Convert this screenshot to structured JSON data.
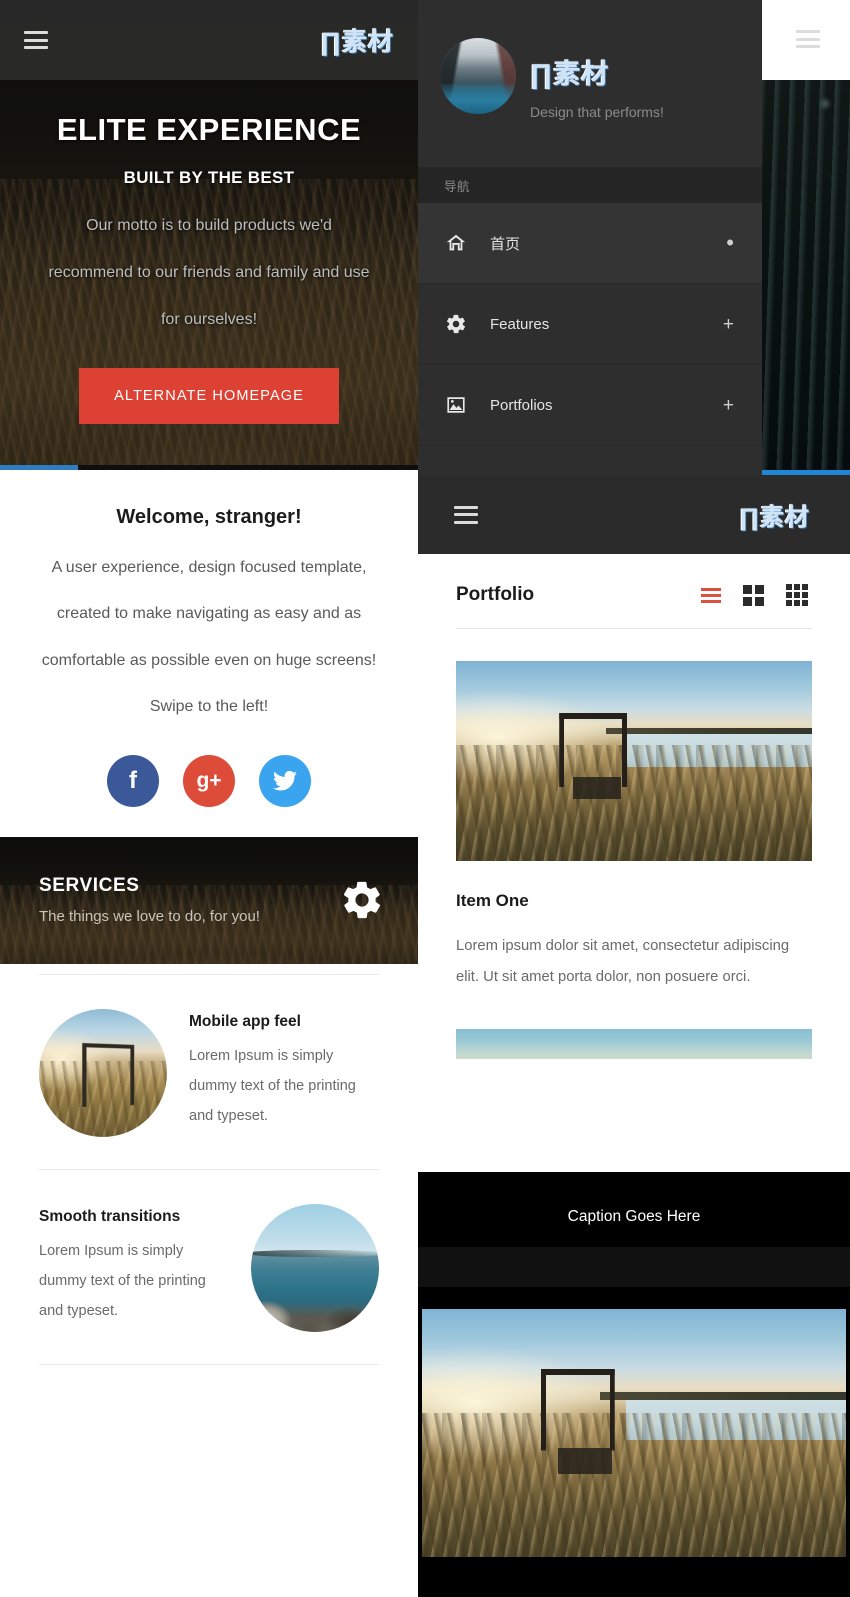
{
  "brand": {
    "logo_text": "∏素材",
    "tagline": "Design that performs!"
  },
  "left_panel": {
    "topbar": {
      "menu_icon": "hamburger-icon",
      "logo_text": "∏素材"
    },
    "hero": {
      "title": "ELITE EXPERIENCE",
      "subtitle": "BUILT BY THE BEST",
      "paragraph": "Our motto is to build products we'd recommend to our friends and family and use for ourselves!",
      "button_label": "ALTERNATE HOMEPAGE",
      "button_color": "#dd4133",
      "progress_color": "#2f7cc0",
      "progress_percent": 19
    },
    "welcome": {
      "title": "Welcome, stranger!",
      "paragraph": "A user experience, design focused template, created to make navigating as easy and as comfortable as possible even on huge screens! Swipe to the left!",
      "socials": [
        {
          "name": "facebook",
          "glyph": "f",
          "color": "#3b5998"
        },
        {
          "name": "google-plus",
          "glyph": "g+",
          "color": "#dd4b39"
        },
        {
          "name": "twitter",
          "glyph": "🐦",
          "color": "#3aa4ef"
        }
      ]
    },
    "services": {
      "title": "SERVICES",
      "subtitle": "The things we love to do, for you!",
      "icon": "gear-icon"
    },
    "features": [
      {
        "title": "Mobile app feel",
        "text": "Lorem Ipsum is simply dummy text of the printing and typeset.",
        "image": "swing-by-the-lake-photo",
        "image_side": "left"
      },
      {
        "title": "Smooth transitions",
        "text": "Lorem Ipsum is simply dummy text of the printing and typeset.",
        "image": "rocky-seashore-photo",
        "image_side": "right"
      }
    ]
  },
  "right_panel": {
    "nav": {
      "logo_text": "∏素材",
      "tagline": "Design that performs!",
      "avatar": "city-street-avatar",
      "menu_icon": "hamburger-icon",
      "section_label": "导航",
      "items": [
        {
          "label": "首页",
          "icon": "home-icon",
          "marker": "•",
          "active": true
        },
        {
          "label": "Features",
          "icon": "gear-icon",
          "marker": "+",
          "active": false
        },
        {
          "label": "Portfolios",
          "icon": "image-icon",
          "marker": "+",
          "active": false
        }
      ]
    },
    "progress_color": "#1f86d6",
    "topbar": {
      "menu_icon": "hamburger-icon",
      "logo_text": "∏素材"
    },
    "portfolio": {
      "heading": "Portfolio",
      "views": [
        {
          "name": "list-view",
          "active": true,
          "color": "#dd4f3e"
        },
        {
          "name": "grid-2-view",
          "active": false,
          "color": "#2b2b2b"
        },
        {
          "name": "grid-3-view",
          "active": false,
          "color": "#2b2b2b"
        }
      ],
      "item": {
        "image": "swing-by-the-lake-photo",
        "title": "Item One",
        "text": "Lorem ipsum dolor sit amet, consectetur adipiscing elit. Ut sit amet porta dolor, non posuere orci."
      },
      "caption": "Caption Goes Here",
      "bottom_image": "swing-by-the-lake-photo"
    }
  }
}
